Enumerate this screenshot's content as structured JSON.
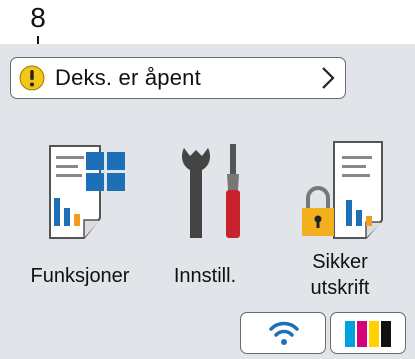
{
  "callout": {
    "number": "8"
  },
  "status": {
    "message": "Deks. er åpent",
    "icon": "warning-icon",
    "chevron_icon": "chevron-right-icon"
  },
  "apps": [
    {
      "label": "Funksjoner",
      "icon": "functions-icon"
    },
    {
      "label": "Innstill.",
      "icon": "settings-tools-icon"
    },
    {
      "label_line1": "Sikker",
      "label_line2": "utskrift",
      "icon": "secure-print-icon"
    }
  ],
  "bottom": {
    "wifi_icon": "wifi-icon",
    "toner_icon": "toner-icon"
  },
  "colors": {
    "screen_bg": "#e1e4e8",
    "accent_blue": "#1d6fb8",
    "warning_yellow": "#f3c61a",
    "lock_yellow": "#f2b01e",
    "toner_cyan": "#00a3e0",
    "toner_magenta": "#d6007a",
    "toner_yellow": "#ffd200",
    "toner_black": "#111111"
  }
}
